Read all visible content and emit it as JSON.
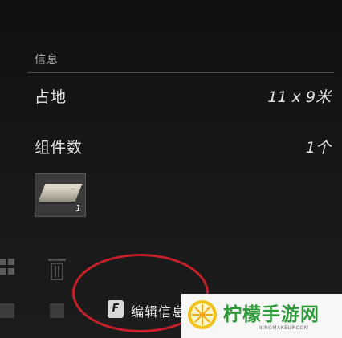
{
  "info_panel": {
    "section_title": "信息",
    "rows": [
      {
        "label": "占地",
        "value": "11 x 9米"
      },
      {
        "label": "组件数",
        "value": "1个"
      }
    ],
    "component": {
      "count": "1"
    }
  },
  "action": {
    "key": "F",
    "label": "编辑信息"
  },
  "watermark": {
    "brand": "柠檬手游网",
    "site": "NINGMAKEUP.COM"
  },
  "annotation": {
    "highlight_color": "#c8202a"
  }
}
